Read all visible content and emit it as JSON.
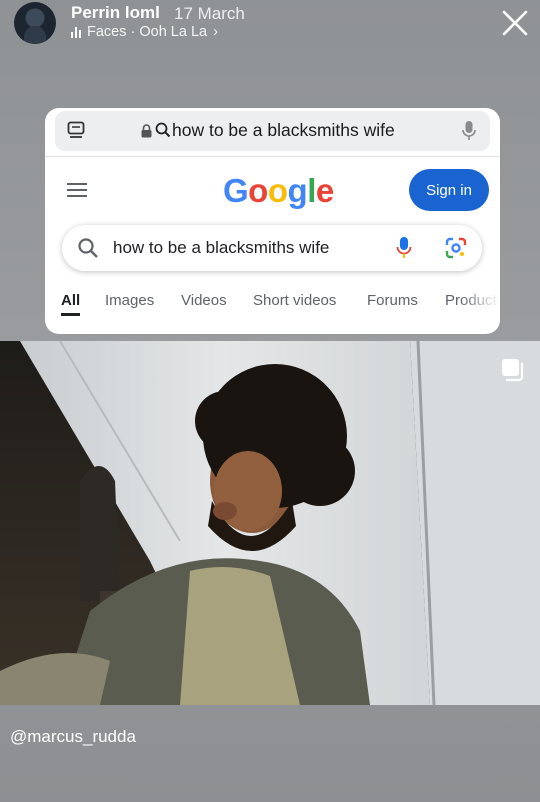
{
  "story": {
    "username": "Perrin loml",
    "timestamp": "17 March",
    "music": "Faces · Ooh La La",
    "music_chevron": "›"
  },
  "browser": {
    "url_text": "how to be a blacksmiths wife"
  },
  "google": {
    "logo_letters": [
      {
        "ch": "G",
        "color": "#4285F4"
      },
      {
        "ch": "o",
        "color": "#EA4335"
      },
      {
        "ch": "o",
        "color": "#FBBC05"
      },
      {
        "ch": "g",
        "color": "#4285F4"
      },
      {
        "ch": "l",
        "color": "#34A853"
      },
      {
        "ch": "e",
        "color": "#EA4335"
      }
    ],
    "signin_label": "Sign in",
    "search_query": "how to be a blacksmiths wife",
    "tabs": [
      "All",
      "Images",
      "Videos",
      "Short videos",
      "Forums",
      "Products"
    ]
  },
  "caption": {
    "handle": "@marcus_rudda"
  },
  "colors": {
    "signin_blue": "#1a64d2",
    "mic_blue": "#1a73e8",
    "mic_yellow": "#fbbc05"
  },
  "icons": [
    "close-icon",
    "tabs-icon",
    "lock-icon",
    "search-icon",
    "mic-icon",
    "hamburger-icon",
    "lens-icon",
    "multi-photo-icon",
    "audio-bars-icon"
  ]
}
